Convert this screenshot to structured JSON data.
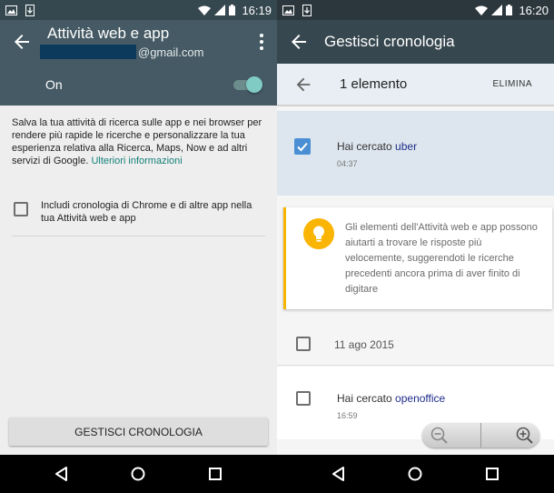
{
  "left": {
    "status": {
      "time": "16:19"
    },
    "appbar": {
      "title": "Attività web e app",
      "account_suffix": "@gmail.com"
    },
    "toggle": {
      "label": "On",
      "state": "on"
    },
    "description": {
      "text": "Salva la tua attività di ricerca sulle app e nei browser per rendere più rapide le ricerche e personalizzare la tua esperienza relativa alla Ricerca, Maps, Now e ad altri servizi di Google.",
      "link": "Ulteriori informazioni"
    },
    "chrome_option": {
      "label": "Includi cronologia di Chrome e di altre app nella tua Attività web e app",
      "checked": false
    },
    "manage_button": "GESTISCI CRONOLOGIA"
  },
  "right": {
    "status": {
      "time": "16:20"
    },
    "appbar": {
      "title": "Gestisci cronologia"
    },
    "selection": {
      "count_label": "1 elemento",
      "delete_label": "ELIMINA"
    },
    "items": [
      {
        "prefix": "Hai cercato",
        "query": "uber",
        "time": "04:37",
        "checked": true
      },
      {
        "prefix": "Hai cercato",
        "query": "openoffice",
        "time": "16:59",
        "checked": false
      }
    ],
    "info": "Gli elementi dell'Attività web e app possono aiutarti a trovare le risposte più velocemente, suggerendoti le ricerche precedenti ancora prima di aver finito di digitare",
    "date_header": "11 ago 2015"
  },
  "colors": {
    "appbar_left": "#455a64",
    "appbar_right": "#37474f",
    "accent_teal": "#80cbc4",
    "checkbox_blue": "#4a8fd4",
    "info_yellow": "#f9b404",
    "link_teal": "#14807a"
  }
}
